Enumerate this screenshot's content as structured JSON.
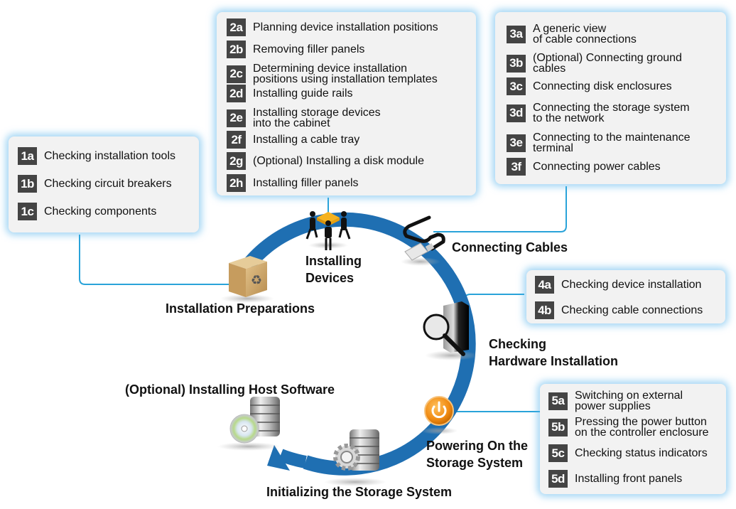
{
  "colors": {
    "cycle_arc": "#1f6fb2",
    "connector": "#29a3d9",
    "badge": "#444444",
    "panel_bg": "#f2f2f2",
    "power_icon": "#f08a12",
    "box_icon": "#c9a062"
  },
  "phases": [
    {
      "id": "1",
      "label": "Installation Preparations",
      "icon": "cardboard-box-icon",
      "steps": [
        {
          "code": "1a",
          "text": "Checking installation tools"
        },
        {
          "code": "1b",
          "text": "Checking circuit breakers"
        },
        {
          "code": "1c",
          "text": "Checking components"
        }
      ]
    },
    {
      "id": "2",
      "label": "Installing\nDevices",
      "icon": "people-carrying-device-icon",
      "steps": [
        {
          "code": "2a",
          "text": "Planning device installation positions"
        },
        {
          "code": "2b",
          "text": "Removing filler panels"
        },
        {
          "code": "2c",
          "text": "Determining device installation\npositions using installation templates"
        },
        {
          "code": "2d",
          "text": "Installing guide rails"
        },
        {
          "code": "2e",
          "text": "Installing storage devices\ninto the cabinet"
        },
        {
          "code": "2f",
          "text": "Installing a cable tray"
        },
        {
          "code": "2g",
          "text": "(Optional) Installing a disk module"
        },
        {
          "code": "2h",
          "text": "Installing filler panels"
        }
      ]
    },
    {
      "id": "3",
      "label": "Connecting Cables",
      "icon": "network-cable-icon",
      "steps": [
        {
          "code": "3a",
          "text": "A generic view\nof cable connections"
        },
        {
          "code": "3b",
          "text": "(Optional) Connecting ground\ncables"
        },
        {
          "code": "3c",
          "text": "Connecting disk enclosures"
        },
        {
          "code": "3d",
          "text": "Connecting the storage system\nto the network"
        },
        {
          "code": "3e",
          "text": "Connecting to the maintenance\nterminal"
        },
        {
          "code": "3f",
          "text": "Connecting power cables"
        }
      ]
    },
    {
      "id": "4",
      "label": "Checking\nHardware Installation",
      "icon": "server-magnifier-icon",
      "steps": [
        {
          "code": "4a",
          "text": "Checking device installation"
        },
        {
          "code": "4b",
          "text": "Checking cable connections"
        }
      ]
    },
    {
      "id": "5",
      "label": "Powering On the\nStorage System",
      "icon": "power-button-icon",
      "steps": [
        {
          "code": "5a",
          "text": "Switching on external\npower supplies"
        },
        {
          "code": "5b",
          "text": "Pressing the power button\non the controller enclosure"
        },
        {
          "code": "5c",
          "text": "Checking status indicators"
        },
        {
          "code": "5d",
          "text": "Installing front panels"
        }
      ]
    },
    {
      "id": "6",
      "label": "Initializing the Storage System",
      "icon": "storage-gear-icon",
      "steps": []
    },
    {
      "id": "7",
      "label": "(Optional) Installing Host Software",
      "icon": "storage-disc-icon",
      "steps": []
    }
  ]
}
